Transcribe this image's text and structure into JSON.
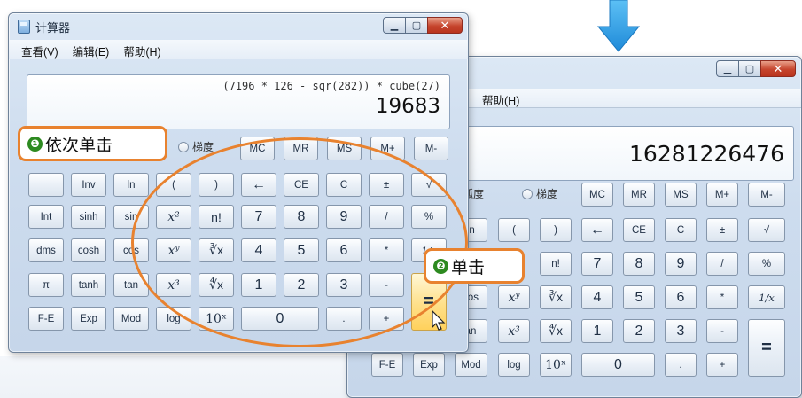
{
  "front_window": {
    "title": "计算器",
    "menu": [
      "查看(V)",
      "编辑(E)",
      "帮助(H)"
    ],
    "expression": "(7196 * 126 - sqr(282)) * cube(27)",
    "result": "19683",
    "radio_label": "梯度",
    "rows": [
      [
        "MC",
        "MR",
        "MS",
        "M+",
        "M-"
      ],
      [
        "",
        "Inv",
        "ln",
        "(",
        ")",
        "←",
        "CE",
        "C",
        "±",
        "√"
      ],
      [
        "Int",
        "sinh",
        "sin",
        "x²",
        "n!",
        "7",
        "8",
        "9",
        "/",
        "%"
      ],
      [
        "dms",
        "cosh",
        "cos",
        "xʸ",
        "∛x",
        "4",
        "5",
        "6",
        "*",
        "1/x"
      ],
      [
        "π",
        "tanh",
        "tan",
        "x³",
        "∜x",
        "1",
        "2",
        "3",
        "-",
        "="
      ],
      [
        "F-E",
        "Exp",
        "Mod",
        "log",
        "10ˣ",
        "0",
        ".",
        "+"
      ]
    ]
  },
  "back_window": {
    "menu": [
      "帮助(H)"
    ],
    "result": "16281226476",
    "radio_labels": [
      "弧度",
      "梯度"
    ],
    "rows": [
      [
        "MC",
        "MR",
        "MS",
        "M+",
        "M-"
      ],
      [
        "In",
        "(",
        ")",
        "←",
        "CE",
        "C",
        "±",
        "√"
      ],
      [
        "n!",
        "7",
        "8",
        "9",
        "/",
        "%"
      ],
      [
        "cos",
        "xʸ",
        "∛x",
        "4",
        "5",
        "6",
        "*",
        "1/x"
      ],
      [
        "an",
        "x³",
        "∜x",
        "1",
        "2",
        "3",
        "-",
        "="
      ],
      [
        "F-E",
        "Exp",
        "Mod",
        "log",
        "10ˣ",
        "0",
        ".",
        "+"
      ]
    ]
  },
  "callouts": {
    "step1_number": "❶",
    "step1_text": "依次单击",
    "step2_number": "❷",
    "step2_text": "单击"
  },
  "colors": {
    "annotation": "#e8822f",
    "step_badge": "#2d8a20",
    "arrow": "#2a9be0"
  }
}
